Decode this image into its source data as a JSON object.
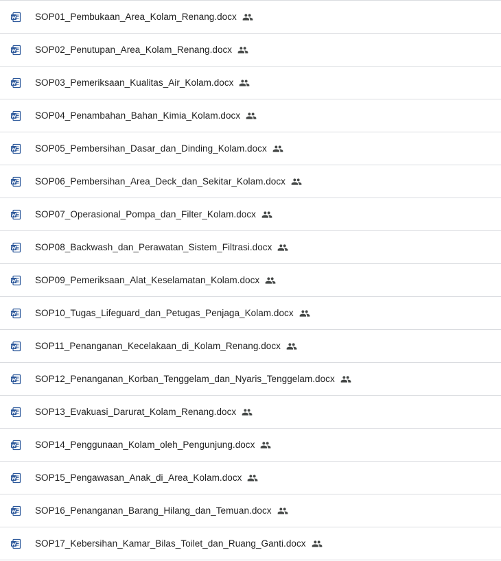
{
  "files": [
    {
      "name": "SOP01_Pembukaan_Area_Kolam_Renang.docx",
      "type_icon": "word-doc-icon",
      "shared_icon": "shared-people-icon"
    },
    {
      "name": "SOP02_Penutupan_Area_Kolam_Renang.docx",
      "type_icon": "word-doc-icon",
      "shared_icon": "shared-people-icon"
    },
    {
      "name": "SOP03_Pemeriksaan_Kualitas_Air_Kolam.docx",
      "type_icon": "word-doc-icon",
      "shared_icon": "shared-people-icon"
    },
    {
      "name": "SOP04_Penambahan_Bahan_Kimia_Kolam.docx",
      "type_icon": "word-doc-icon",
      "shared_icon": "shared-people-icon"
    },
    {
      "name": "SOP05_Pembersihan_Dasar_dan_Dinding_Kolam.docx",
      "type_icon": "word-doc-icon",
      "shared_icon": "shared-people-icon"
    },
    {
      "name": "SOP06_Pembersihan_Area_Deck_dan_Sekitar_Kolam.docx",
      "type_icon": "word-doc-icon",
      "shared_icon": "shared-people-icon"
    },
    {
      "name": "SOP07_Operasional_Pompa_dan_Filter_Kolam.docx",
      "type_icon": "word-doc-icon",
      "shared_icon": "shared-people-icon"
    },
    {
      "name": "SOP08_Backwash_dan_Perawatan_Sistem_Filtrasi.docx",
      "type_icon": "word-doc-icon",
      "shared_icon": "shared-people-icon"
    },
    {
      "name": "SOP09_Pemeriksaan_Alat_Keselamatan_Kolam.docx",
      "type_icon": "word-doc-icon",
      "shared_icon": "shared-people-icon"
    },
    {
      "name": "SOP10_Tugas_Lifeguard_dan_Petugas_Penjaga_Kolam.docx",
      "type_icon": "word-doc-icon",
      "shared_icon": "shared-people-icon"
    },
    {
      "name": "SOP11_Penanganan_Kecelakaan_di_Kolam_Renang.docx",
      "type_icon": "word-doc-icon",
      "shared_icon": "shared-people-icon"
    },
    {
      "name": "SOP12_Penanganan_Korban_Tenggelam_dan_Nyaris_Tenggelam.docx",
      "type_icon": "word-doc-icon",
      "shared_icon": "shared-people-icon"
    },
    {
      "name": "SOP13_Evakuasi_Darurat_Kolam_Renang.docx",
      "type_icon": "word-doc-icon",
      "shared_icon": "shared-people-icon"
    },
    {
      "name": "SOP14_Penggunaan_Kolam_oleh_Pengunjung.docx",
      "type_icon": "word-doc-icon",
      "shared_icon": "shared-people-icon"
    },
    {
      "name": "SOP15_Pengawasan_Anak_di_Area_Kolam.docx",
      "type_icon": "word-doc-icon",
      "shared_icon": "shared-people-icon"
    },
    {
      "name": "SOP16_Penanganan_Barang_Hilang_dan_Temuan.docx",
      "type_icon": "word-doc-icon",
      "shared_icon": "shared-people-icon"
    },
    {
      "name": "SOP17_Kebersihan_Kamar_Bilas_Toilet_dan_Ruang_Ganti.docx",
      "type_icon": "word-doc-icon",
      "shared_icon": "shared-people-icon"
    }
  ],
  "colors": {
    "word_blue": "#2b579a",
    "text": "#1f1f1f",
    "shared_icon": "#444746",
    "divider": "#dadce0"
  }
}
